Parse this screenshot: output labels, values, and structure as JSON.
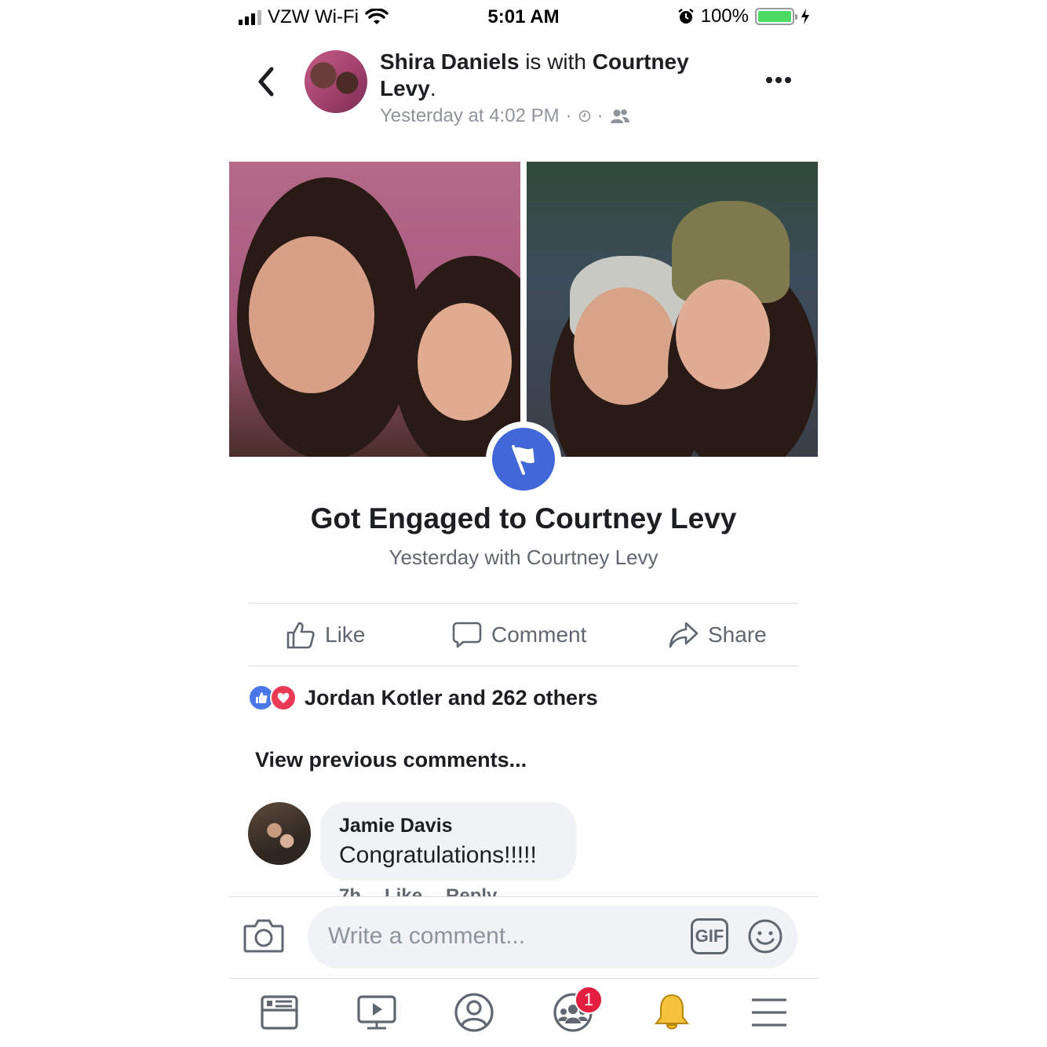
{
  "status_bar": {
    "carrier": "VZW Wi-Fi",
    "time": "5:01 AM",
    "battery": "100%"
  },
  "header": {
    "author": "Shira Daniels",
    "with_text": "is with",
    "tagged": "Courtney Levy",
    "period": ".",
    "timestamp": "Yesterday at 4:02 PM",
    "separator": "·"
  },
  "event": {
    "title": "Got Engaged to Courtney Levy",
    "subtitle": "Yesterday with Courtney Levy",
    "badge_color": "#4267d8"
  },
  "actions": {
    "like": "Like",
    "comment": "Comment",
    "share": "Share"
  },
  "reactions": {
    "text": "Jordan Kotler and 262 others",
    "like_color": "#4a77e8",
    "love_color": "#ea3a55"
  },
  "comments": {
    "view_previous": "View previous comments...",
    "items": [
      {
        "author": "Jamie Davis",
        "text": "Congratulations!!!!!",
        "time": "7h",
        "like": "Like",
        "reply": "Reply"
      }
    ]
  },
  "composer": {
    "placeholder": "Write a comment...",
    "gif_label": "GIF"
  },
  "tabbar": {
    "items": [
      "news-feed-icon",
      "watch-icon",
      "profile-icon",
      "groups-icon",
      "notifications-icon",
      "menu-icon"
    ],
    "groups_badge": "1"
  }
}
